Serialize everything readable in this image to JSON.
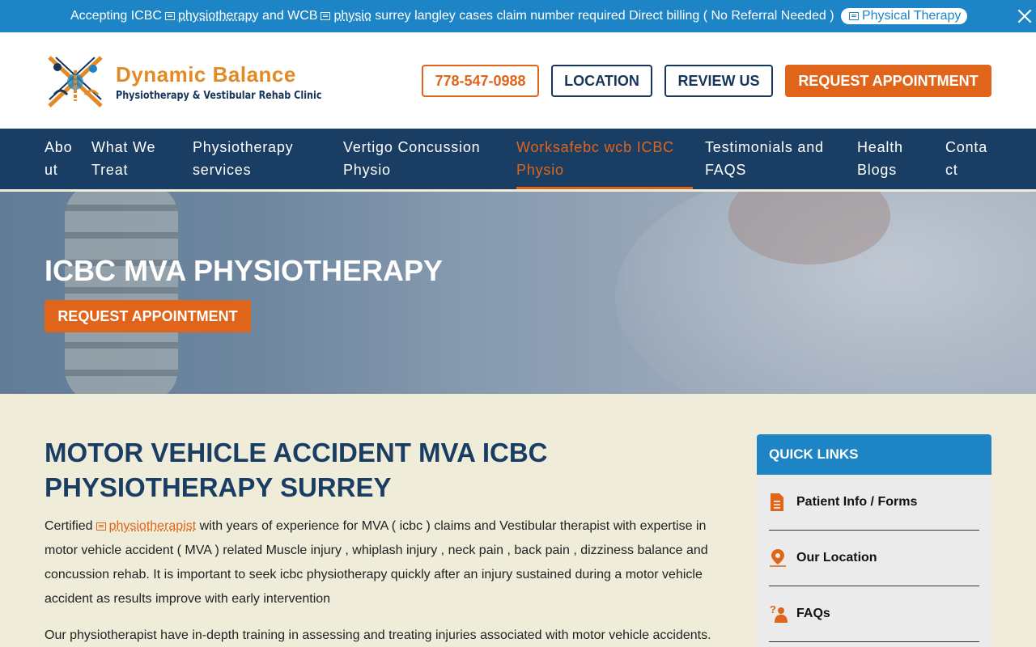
{
  "topbar": {
    "part1": "Accepting ICBC",
    "link1": "physiotherapy",
    "part2": "and WCB",
    "link2": "physio",
    "part3": "surrey langley cases claim number required Direct billing ( No Referral Needed )",
    "pill": "Physical Therapy"
  },
  "header": {
    "logo_title": "Dynamic Balance",
    "logo_subtitle": "Physiotherapy & Vestibular Rehab Clinic",
    "phone": "778-547-0988",
    "location": "LOCATION",
    "review": "REVIEW US",
    "request": "REQUEST APPOINTMENT"
  },
  "nav": {
    "items": [
      {
        "line1": "Abo",
        "line2": "ut"
      },
      {
        "line1": "What We",
        "line2": "Treat"
      },
      {
        "line1": "Physiotherapy",
        "line2": "services"
      },
      {
        "line1": "Vertigo Concussion",
        "line2": "Physio"
      },
      {
        "line1": "Worksafebc wcb ICBC",
        "line2": "Physio"
      },
      {
        "line1": "Testimonials and",
        "line2": "FAQS"
      },
      {
        "line1": "Health",
        "line2": "Blogs"
      },
      {
        "line1": "Conta",
        "line2": "ct"
      }
    ]
  },
  "hero": {
    "title": "ICBC MVA PHYSIOTHERAPY",
    "button": "REQUEST APPOINTMENT"
  },
  "main": {
    "title": "MOTOR VEHICLE ACCIDENT MVA ICBC PHYSIOTHERAPY SURREY",
    "para1_start": "Certified",
    "para1_link": "physiotherapist",
    "para1_rest": "with years of experience for MVA ( icbc ) claims and Vestibular therapist with expertise in motor vehicle accident ( MVA ) related Muscle injury , whiplash injury , neck pain , back pain , dizziness balance and concussion rehab. It is important to seek icbc physiotherapy quickly after an injury sustained during a motor vehicle accident as results improve with early intervention",
    "para2": "Our physiotherapist have in-depth training in assessing and treating injuries associated with motor vehicle accidents."
  },
  "quick_links": {
    "heading": "QUICK LINKS",
    "items": [
      {
        "label": "Patient Info / Forms",
        "icon": "document-icon"
      },
      {
        "label": "Our Location",
        "icon": "map-pin-icon"
      },
      {
        "label": "FAQs",
        "icon": "question-person-icon"
      }
    ]
  },
  "colors": {
    "topbar": "#1d84c6",
    "nav": "#1a3e63",
    "accent": "#e0651b",
    "navy": "#17355b",
    "content_bg": "#f0ecda"
  }
}
